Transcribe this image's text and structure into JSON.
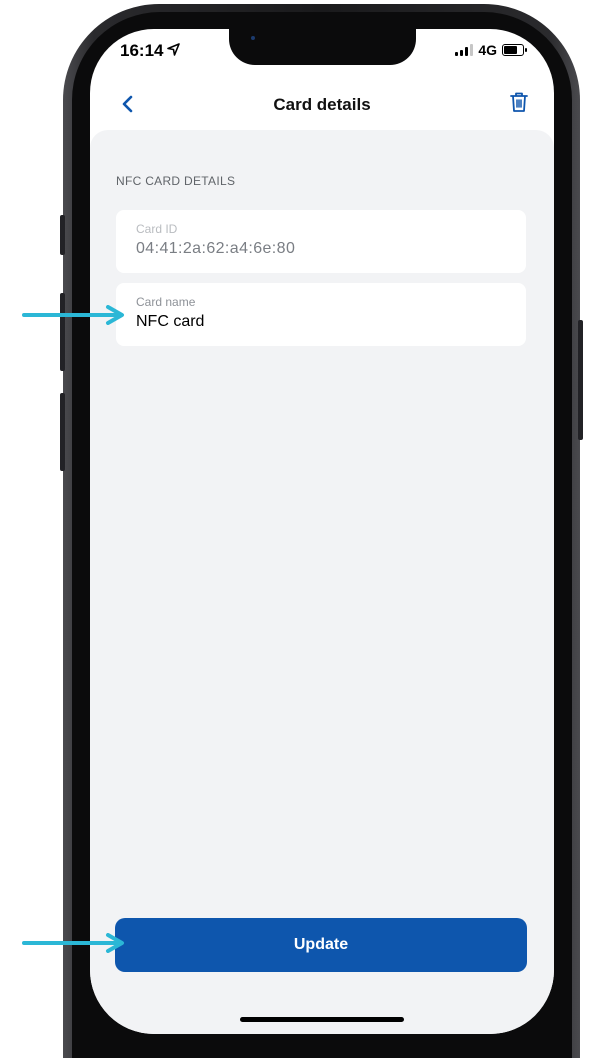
{
  "status_bar": {
    "time": "16:14",
    "network": "4G",
    "icons": [
      "location-arrow-icon",
      "signal-icon",
      "battery-icon"
    ]
  },
  "nav": {
    "title": "Card details",
    "back_icon": "chevron-left-icon",
    "delete_icon": "trash-icon"
  },
  "section": {
    "label": "NFC CARD DETAILS"
  },
  "fields": {
    "card_id": {
      "label": "Card ID",
      "value": "04:41:2a:62:a4:6e:80"
    },
    "card_name": {
      "label": "Card name",
      "value": "NFC card"
    }
  },
  "actions": {
    "update_label": "Update"
  },
  "colors": {
    "accent": "#0e56ad",
    "annotation_arrow": "#2bb7d6",
    "screen_background": "#f2f3f5"
  }
}
